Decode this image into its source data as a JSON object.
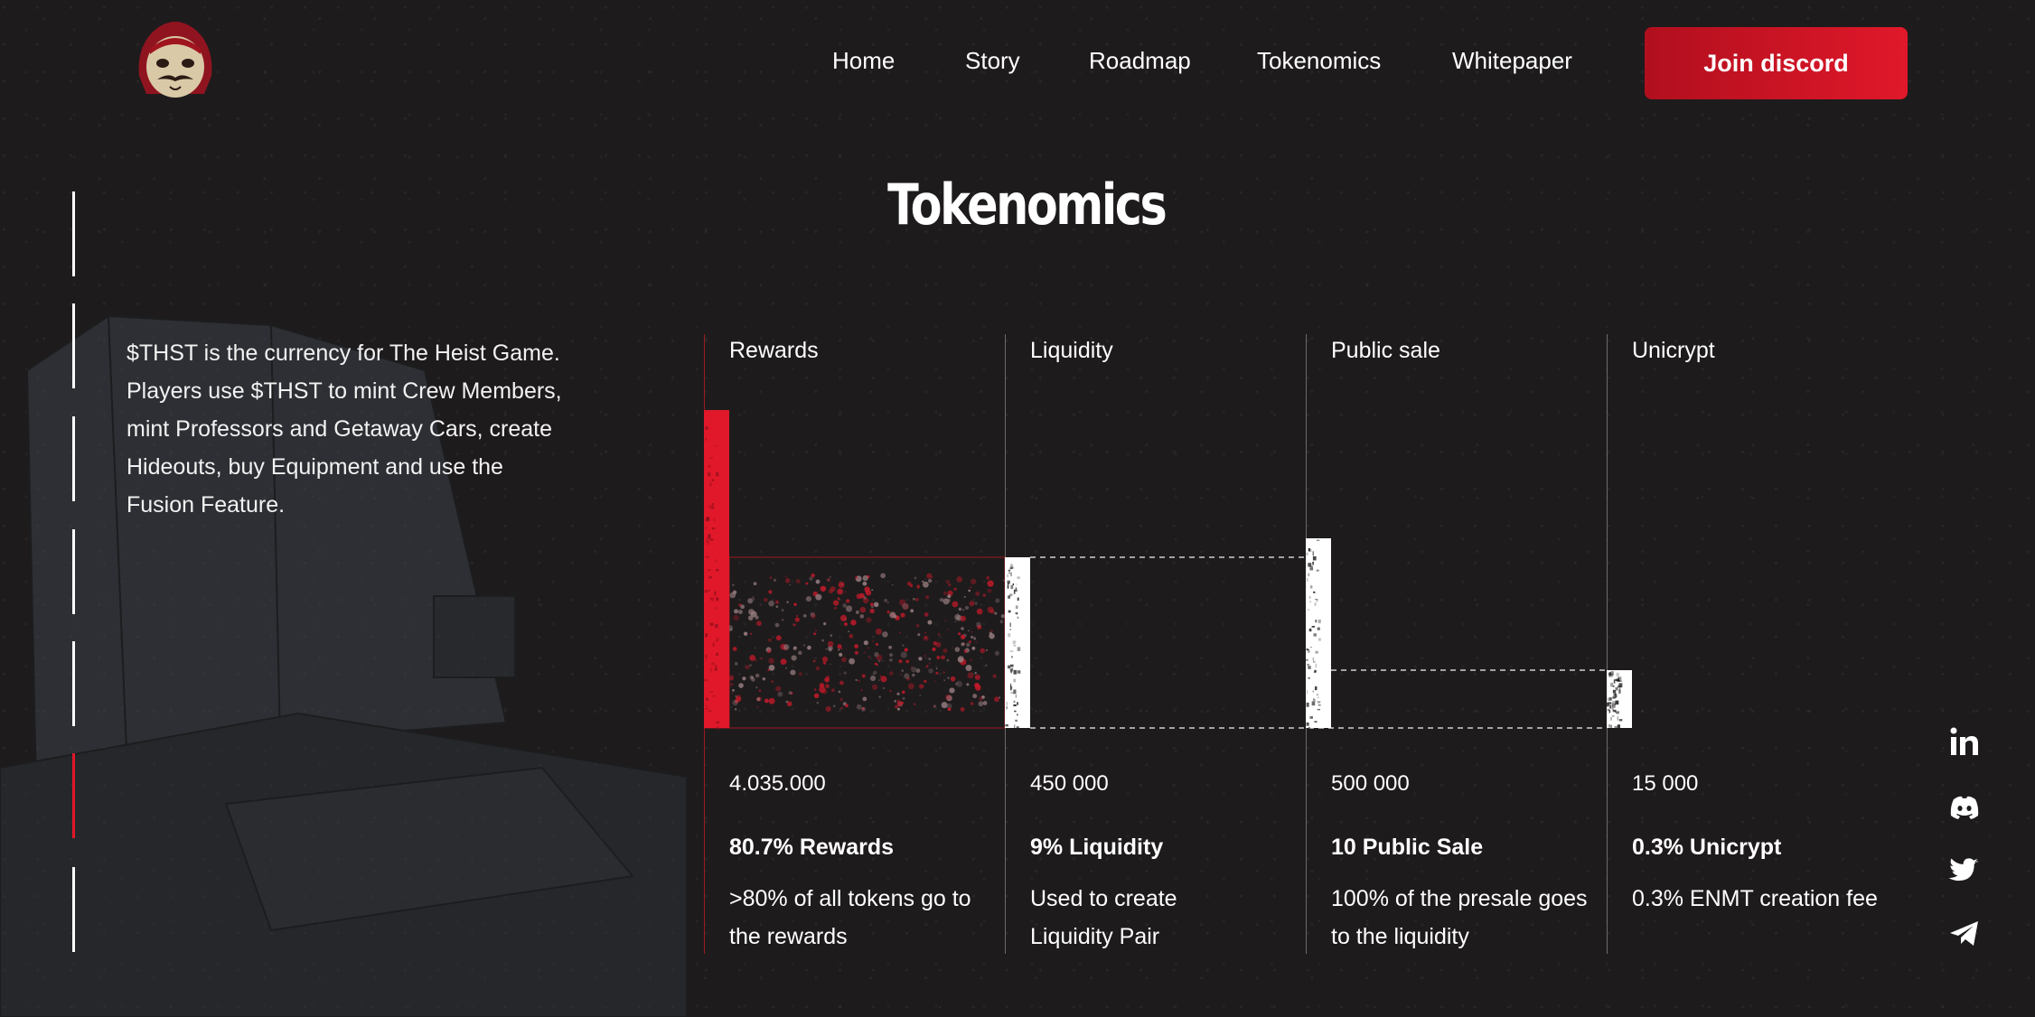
{
  "nav": {
    "items": [
      "Home",
      "Story",
      "Roadmap",
      "Tokenomics",
      "Whitepaper"
    ],
    "cta_label": "Join discord"
  },
  "page_title": "Tokenomics",
  "intro_text": "$THST is the currency for The Heist Game. Players use $THST to mint Crew Members, mint Professors and Getaway Cars, create Hideouts, buy Equipment and use the Fusion Feature.",
  "colors": {
    "accent": "#e0182a",
    "background": "#1e1b1c",
    "text": "#ffffff"
  },
  "chart_data": {
    "type": "bar",
    "categories": [
      "Rewards",
      "Liquidity",
      "Public sale",
      "Unicrypt"
    ],
    "values": [
      4035000,
      450000,
      500000,
      15000
    ],
    "amount_labels": [
      "4.035.000",
      "450 000",
      "500 000",
      "15 000"
    ],
    "percent_labels": [
      "80.7% Rewards",
      "9% Liquidity",
      "10 Public Sale",
      "0.3% Unicrypt"
    ],
    "descriptions": [
      ">80% of all tokens go to the rewards",
      "Used to create Liquidity Pair",
      "100% of the presale goes to the liquidity",
      "0.3% ENMT creation fee"
    ],
    "bar_colors": [
      "#e0182a",
      "#ffffff",
      "#ffffff",
      "#ffffff"
    ]
  },
  "social": [
    "linkedin-icon",
    "discord-icon",
    "twitter-icon",
    "telegram-icon"
  ]
}
